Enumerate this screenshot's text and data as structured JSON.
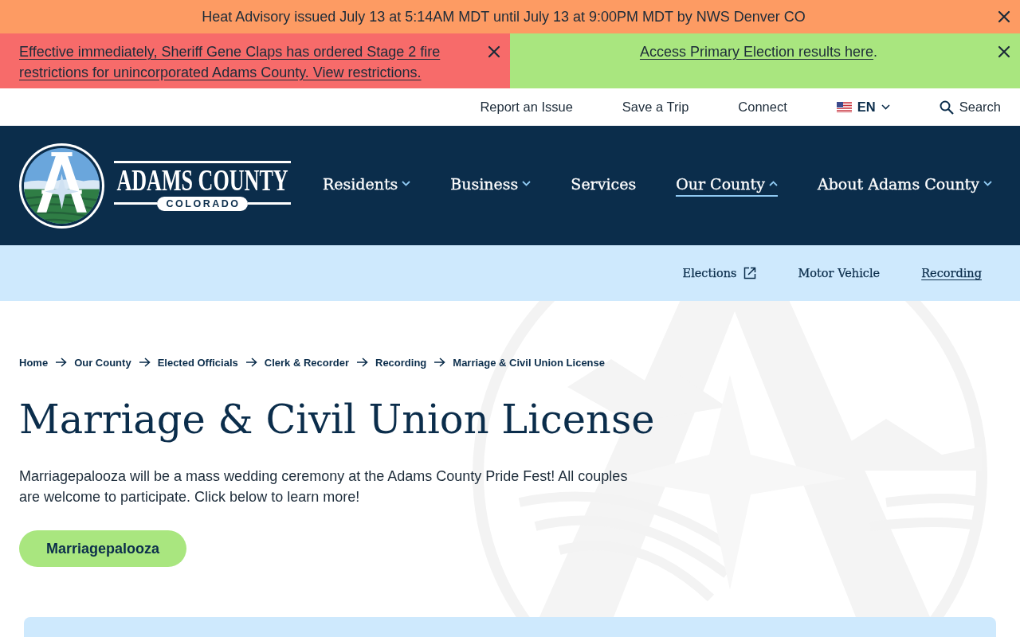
{
  "alerts": [
    {
      "kind": "advisory",
      "text": "Heat Advisory issued July 13 at 5:14AM MDT until July 13 at 9:00PM MDT by NWS Denver CO"
    },
    {
      "kind": "danger",
      "link": "Effective immediately, Sheriff Gene Claps has ordered Stage 2 fire restrictions for unincorporated Adams County. View restrictions."
    },
    {
      "kind": "success",
      "link": "Access Primary Election results here",
      "suffix": "."
    }
  ],
  "utility_links": [
    {
      "label": "Report an Issue"
    },
    {
      "label": "Save a Trip"
    },
    {
      "label": "Connect"
    }
  ],
  "language": {
    "code": "EN"
  },
  "search": {
    "label": "Search"
  },
  "logo": {
    "name": "ADAMS COUNTY",
    "subtitle": "COLORADO"
  },
  "nav": [
    {
      "label": "Residents",
      "kind": "menu",
      "expanded": false,
      "selected": false
    },
    {
      "label": "Business",
      "kind": "menu",
      "expanded": false,
      "selected": false
    },
    {
      "label": "Services",
      "kind": "link",
      "selected": false
    },
    {
      "label": "Our County",
      "kind": "menu",
      "expanded": true,
      "selected": true
    },
    {
      "label": "About Adams County",
      "kind": "menu",
      "expanded": false,
      "selected": false
    }
  ],
  "subnav": [
    {
      "label": "Elections",
      "external": true,
      "selected": false
    },
    {
      "label": "Motor Vehicle",
      "external": false,
      "selected": false
    },
    {
      "label": "Recording",
      "external": false,
      "selected": true
    }
  ],
  "breadcrumb": [
    "Home",
    "Our County",
    "Elected Officials",
    "Clerk & Recorder",
    "Recording",
    "Marriage & Civil Union License"
  ],
  "title": "Marriage & Civil Union License",
  "intro": "Marriagepalooza will be a mass wedding ceremony at the Adams County Pride Fest! All couples are welcome to participate. Click below to learn more!",
  "button": {
    "label": "Marriagepalooza"
  }
}
